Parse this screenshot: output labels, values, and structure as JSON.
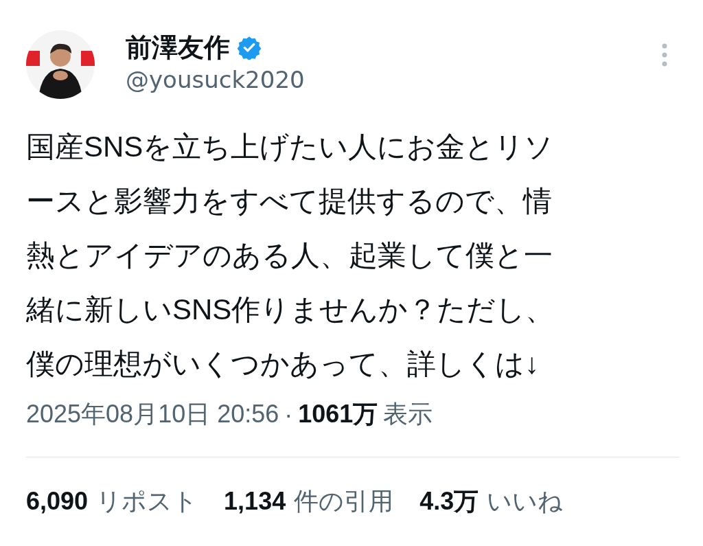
{
  "author": {
    "name": "前澤友作",
    "verified": true,
    "handle": "@yousuck2020"
  },
  "text_lines": [
    "国産SNSを立ち上げたい人にお金とリソ",
    "ースと影響力をすべて提供するので、情",
    "熱とアイデアのある人、起業して僕と一",
    "緒に新しいSNS作りませんか？ただし、",
    "僕の理想がいくつかあって、詳しくは↓"
  ],
  "meta": {
    "timestamp": "2025年08月10日 20:56",
    "separator": "·",
    "views_count": "1061万",
    "views_label": "表示"
  },
  "stats": [
    {
      "count": "6,090",
      "label": "リポスト"
    },
    {
      "count": "1,134",
      "label": "件の引用"
    },
    {
      "count": "4.3万",
      "label": "いいね"
    }
  ]
}
